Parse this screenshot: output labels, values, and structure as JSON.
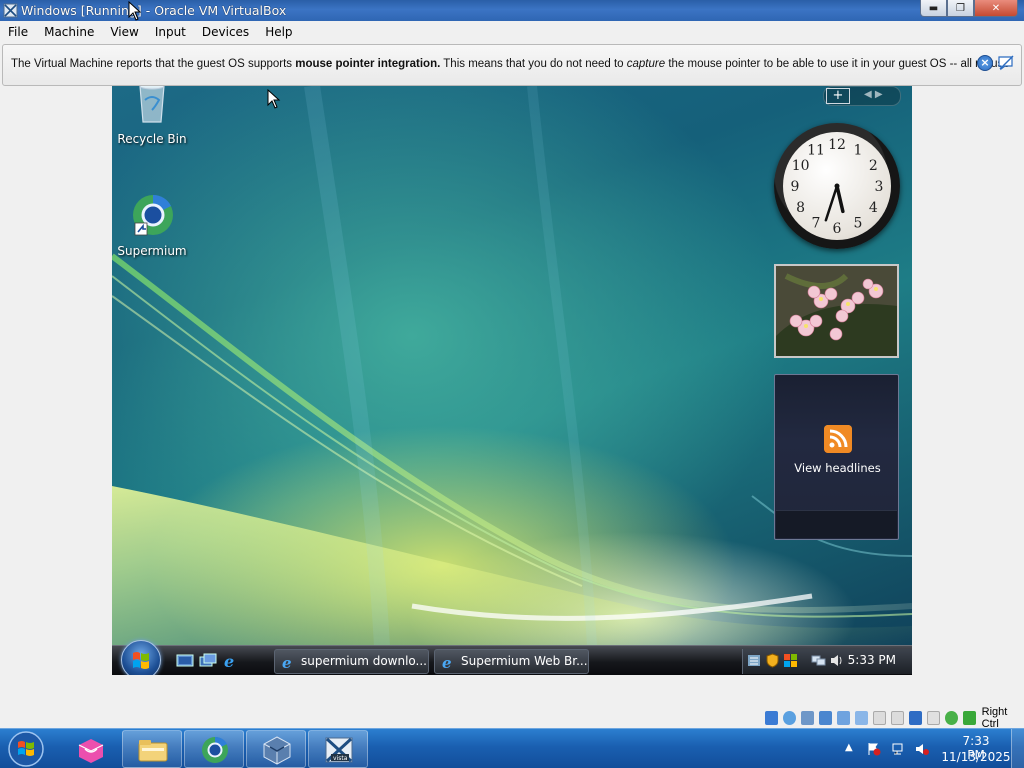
{
  "window": {
    "title": "Windows [Running] - Oracle VM VirtualBox",
    "minimize_icon": "minimize-icon",
    "maximize_icon": "maximize-icon",
    "close_icon": "close-icon"
  },
  "menu": {
    "items": [
      "File",
      "Machine",
      "View",
      "Input",
      "Devices",
      "Help"
    ]
  },
  "notification": {
    "text_before": "The Virtual Machine reports that the guest OS supports ",
    "bold": "mouse pointer integration.",
    "text_middle": " This means that you do not need to ",
    "italic": "capture",
    "text_after": " the mouse pointer to be able to use it in your guest OS -- all mouse"
  },
  "guest": {
    "desktop_icons": [
      {
        "label": "Recycle Bin",
        "icon": "recycle-bin-icon"
      },
      {
        "label": "Supermium",
        "icon": "supermium-icon"
      }
    ],
    "sidebar": {
      "add_label": "+",
      "feed_label": "View headlines"
    },
    "clock": {
      "numbers": [
        "12",
        "1",
        "2",
        "3",
        "4",
        "5",
        "6",
        "7",
        "8",
        "9",
        "10",
        "11"
      ]
    },
    "taskbar": {
      "tasks": [
        "supermium downlo...",
        "Supermium Web Br..."
      ],
      "time": "5:33 PM"
    }
  },
  "vbox_status": {
    "host_key": "Right Ctrl"
  },
  "host_taskbar": {
    "time": "7:33 PM",
    "date": "11/13/2025",
    "pinned": [
      "ie-like-icon",
      "explorer-icon",
      "supermium-icon",
      "virtualbox-icon",
      "vista-vm-icon"
    ]
  },
  "colors": {
    "accent": "#2c6cc0",
    "titlebar": "#3b74c4",
    "guest_taskbar": "#16181c",
    "host_taskbar": "#1a5fb0"
  }
}
